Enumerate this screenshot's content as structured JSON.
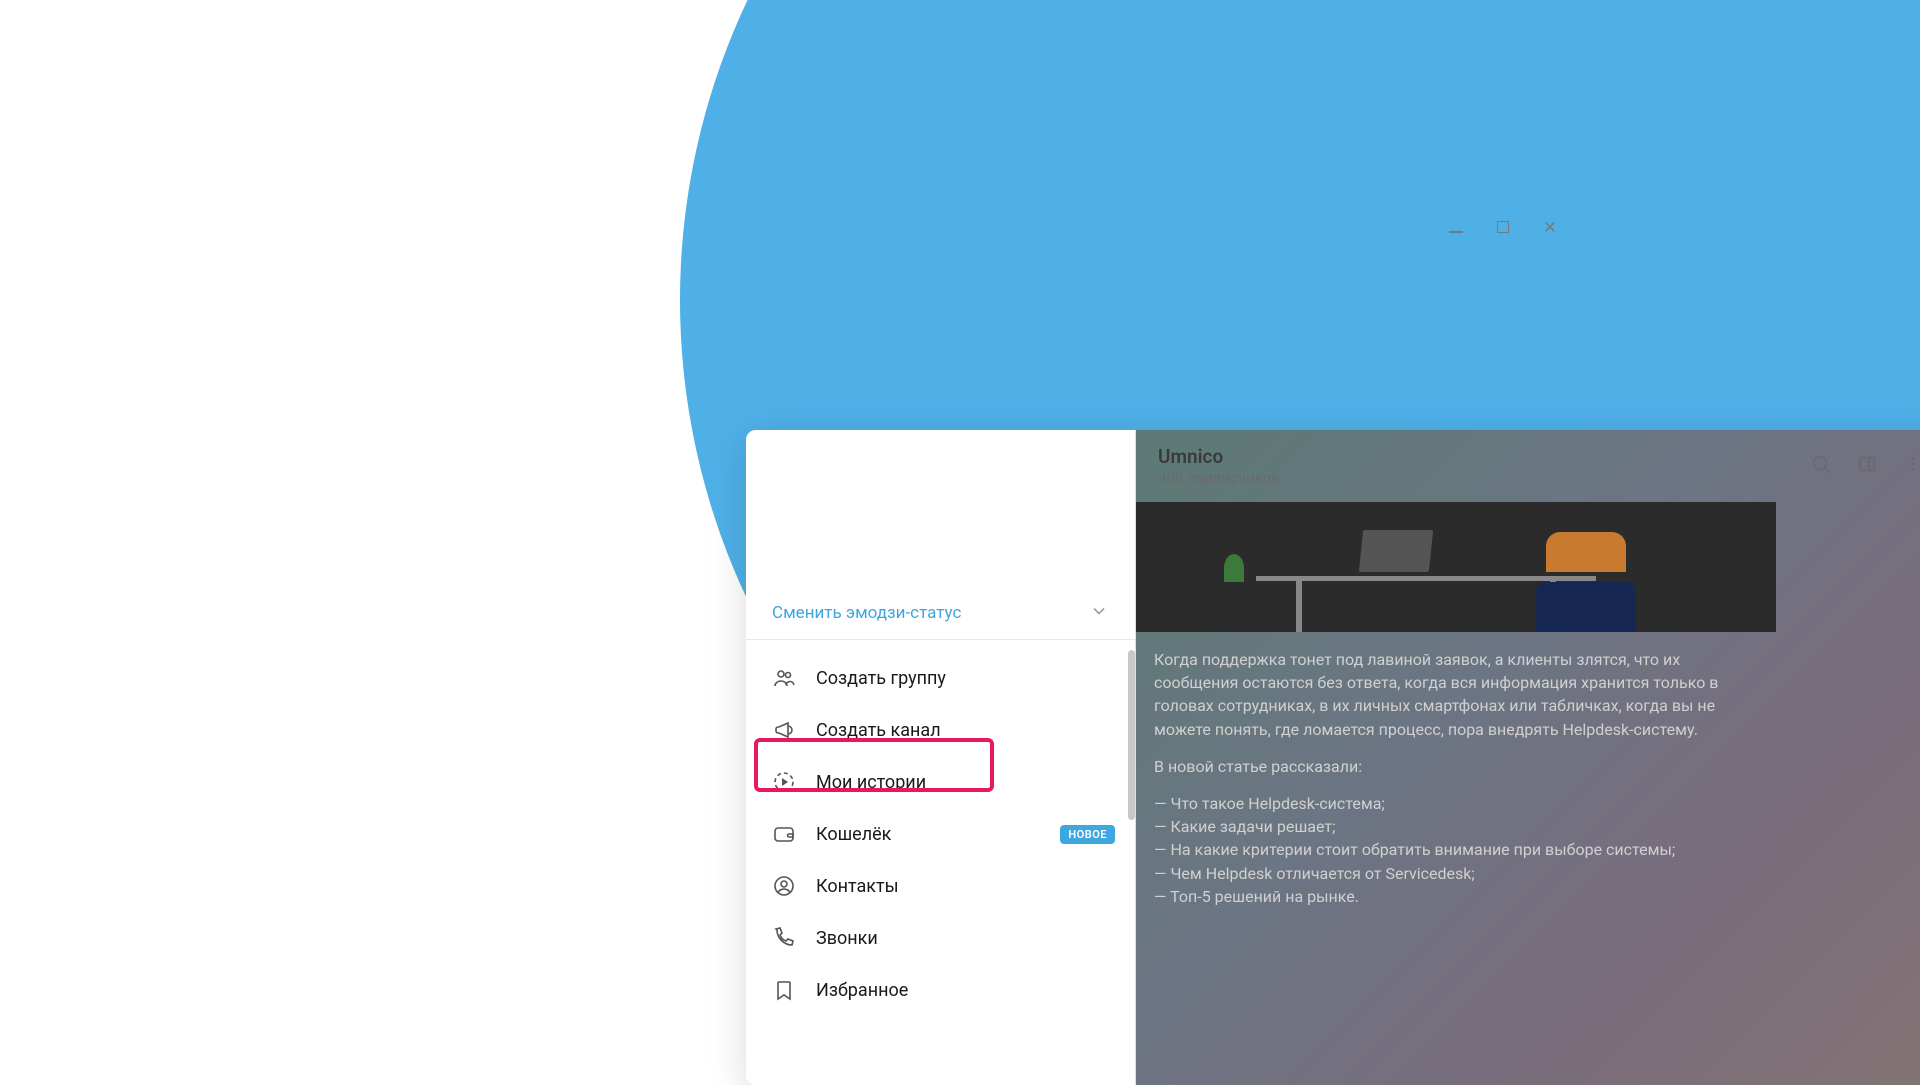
{
  "sidebar": {
    "emoji_status": "Сменить эмодзи-статус",
    "menu": [
      {
        "label": "Создать группу",
        "icon": "group-icon"
      },
      {
        "label": "Создать канал",
        "icon": "megaphone-icon",
        "highlighted": true
      },
      {
        "label": "Мои истории",
        "icon": "stories-icon"
      },
      {
        "label": "Кошелёк",
        "icon": "wallet-icon",
        "badge": "НОВОЕ"
      },
      {
        "label": "Контакты",
        "icon": "contacts-icon"
      },
      {
        "label": "Звонки",
        "icon": "phone-icon"
      },
      {
        "label": "Избранное",
        "icon": "bookmark-icon"
      }
    ]
  },
  "chat": {
    "title": "Umnico",
    "subtitle": "409 подписчиков",
    "message": {
      "p1": "Когда поддержка тонет под лавиной заявок, а клиенты злятся, что их сообщения остаются без ответа, когда вся информация хранится только в головах сотрудниках, в их личных смартфонах или табличках, когда вы не можете понять, где ломается процесс, пора внедрять Helpdesk-систему.",
      "p2": "В новой статье рассказали:",
      "l1": "— Что такое Helpdesk-система;",
      "l2": "— Какие задачи решает;",
      "l3": "— На какие критерии стоит обратить внимание при выборе системы;",
      "l4": "— Чем Helpdesk отличается от Servicedesk;",
      "l5": "— Топ-5 решений на рынке."
    }
  },
  "colors": {
    "accent": "#4FB0E8",
    "highlight": "#E6195E",
    "link": "#3DA6E0"
  }
}
